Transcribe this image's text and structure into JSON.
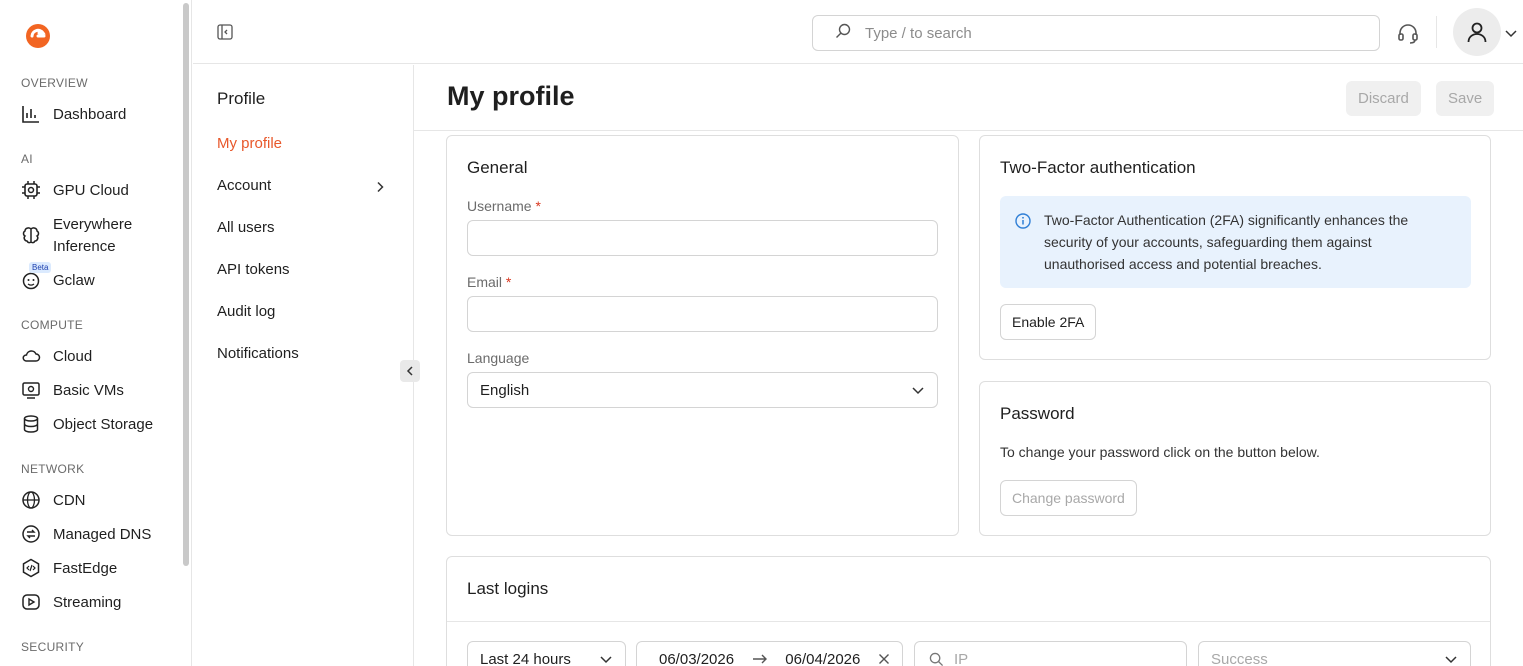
{
  "sidebar": {
    "sections": [
      {
        "title": "OVERVIEW",
        "items": [
          {
            "label": "Dashboard",
            "icon": "bar-chart-icon"
          }
        ]
      },
      {
        "title": "AI",
        "items": [
          {
            "label": "GPU Cloud",
            "icon": "chip-icon"
          },
          {
            "label": "Everywhere",
            "label2": "Inference",
            "icon": "brain-icon"
          },
          {
            "label": "Gclaw",
            "icon": "bot-face-icon",
            "badge": "Beta"
          }
        ]
      },
      {
        "title": "COMPUTE",
        "items": [
          {
            "label": "Cloud",
            "icon": "cloud-icon"
          },
          {
            "label": "Basic VMs",
            "icon": "monitor-icon"
          },
          {
            "label": "Object Storage",
            "icon": "database-icon"
          }
        ]
      },
      {
        "title": "NETWORK",
        "items": [
          {
            "label": "CDN",
            "icon": "globe-icon"
          },
          {
            "label": "Managed DNS",
            "icon": "dns-icon"
          },
          {
            "label": "FastEdge",
            "icon": "code-hex-icon"
          },
          {
            "label": "Streaming",
            "icon": "play-icon"
          }
        ]
      },
      {
        "title": "SECURITY",
        "items": []
      }
    ]
  },
  "topbar": {
    "search_placeholder": "Type / to search"
  },
  "subnav": {
    "title": "Profile",
    "items": [
      {
        "label": "My profile",
        "active": true
      },
      {
        "label": "Account",
        "has_chevron": true
      },
      {
        "label": "All users"
      },
      {
        "label": "API tokens"
      },
      {
        "label": "Audit log"
      },
      {
        "label": "Notifications"
      }
    ]
  },
  "page": {
    "title": "My profile",
    "discard_label": "Discard",
    "save_label": "Save"
  },
  "general": {
    "title": "General",
    "username_label": "Username",
    "email_label": "Email",
    "required_mark": "*",
    "username_value": "",
    "email_value": "",
    "language_label": "Language",
    "language_value": "English"
  },
  "twofa": {
    "title": "Two-Factor authentication",
    "info": "Two-Factor Authentication (2FA) significantly enhances the security of your accounts, safeguarding them against unauthorised access and potential breaches.",
    "enable_label": "Enable 2FA"
  },
  "password": {
    "title": "Password",
    "text": "To change your password click on the button below.",
    "change_label": "Change password"
  },
  "logins": {
    "title": "Last logins",
    "period_value": "Last 24 hours",
    "date_from": "06/03/2026",
    "date_to": "06/04/2026",
    "ip_placeholder": "IP",
    "status_placeholder": "Success"
  },
  "colors": {
    "accent": "#e8582b",
    "info_bg": "#e8f2fd",
    "required": "#d9361e"
  }
}
